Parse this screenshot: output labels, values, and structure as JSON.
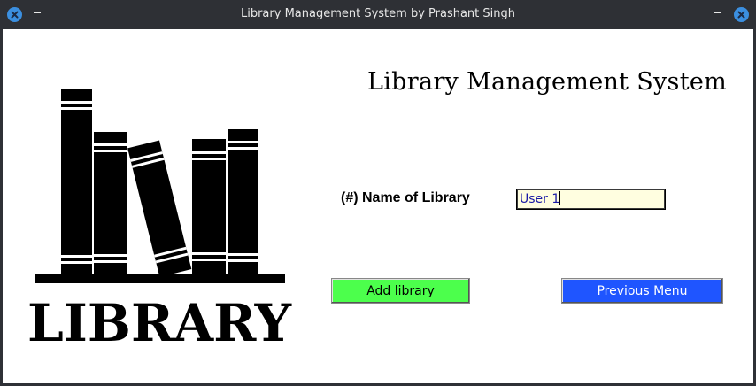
{
  "window": {
    "title": "Library Management System by Prashant Singh"
  },
  "logo": {
    "text": "LIBRARY"
  },
  "main": {
    "heading": "Library Management System",
    "field_label": "(#) Name of Library",
    "field_value": "User 1",
    "add_button": "Add library",
    "prev_button": "Previous Menu"
  },
  "colors": {
    "add_button_bg": "#4cff4c",
    "prev_button_bg": "#1f55ff",
    "input_bg": "#fffee0",
    "titlebar_bg": "#2e3035"
  }
}
